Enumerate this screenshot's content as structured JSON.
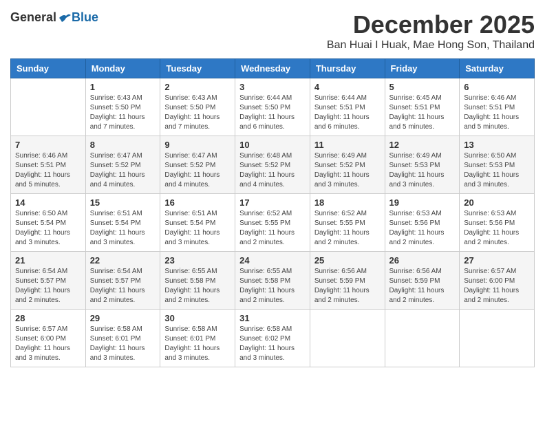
{
  "header": {
    "logo_general": "General",
    "logo_blue": "Blue",
    "month_title": "December 2025",
    "location": "Ban Huai I Huak, Mae Hong Son, Thailand"
  },
  "days_of_week": [
    "Sunday",
    "Monday",
    "Tuesday",
    "Wednesday",
    "Thursday",
    "Friday",
    "Saturday"
  ],
  "weeks": [
    [
      {
        "day": "",
        "info": ""
      },
      {
        "day": "1",
        "info": "Sunrise: 6:43 AM\nSunset: 5:50 PM\nDaylight: 11 hours and 7 minutes."
      },
      {
        "day": "2",
        "info": "Sunrise: 6:43 AM\nSunset: 5:50 PM\nDaylight: 11 hours and 7 minutes."
      },
      {
        "day": "3",
        "info": "Sunrise: 6:44 AM\nSunset: 5:50 PM\nDaylight: 11 hours and 6 minutes."
      },
      {
        "day": "4",
        "info": "Sunrise: 6:44 AM\nSunset: 5:51 PM\nDaylight: 11 hours and 6 minutes."
      },
      {
        "day": "5",
        "info": "Sunrise: 6:45 AM\nSunset: 5:51 PM\nDaylight: 11 hours and 5 minutes."
      },
      {
        "day": "6",
        "info": "Sunrise: 6:46 AM\nSunset: 5:51 PM\nDaylight: 11 hours and 5 minutes."
      }
    ],
    [
      {
        "day": "7",
        "info": "Sunrise: 6:46 AM\nSunset: 5:51 PM\nDaylight: 11 hours and 5 minutes."
      },
      {
        "day": "8",
        "info": "Sunrise: 6:47 AM\nSunset: 5:52 PM\nDaylight: 11 hours and 4 minutes."
      },
      {
        "day": "9",
        "info": "Sunrise: 6:47 AM\nSunset: 5:52 PM\nDaylight: 11 hours and 4 minutes."
      },
      {
        "day": "10",
        "info": "Sunrise: 6:48 AM\nSunset: 5:52 PM\nDaylight: 11 hours and 4 minutes."
      },
      {
        "day": "11",
        "info": "Sunrise: 6:49 AM\nSunset: 5:52 PM\nDaylight: 11 hours and 3 minutes."
      },
      {
        "day": "12",
        "info": "Sunrise: 6:49 AM\nSunset: 5:53 PM\nDaylight: 11 hours and 3 minutes."
      },
      {
        "day": "13",
        "info": "Sunrise: 6:50 AM\nSunset: 5:53 PM\nDaylight: 11 hours and 3 minutes."
      }
    ],
    [
      {
        "day": "14",
        "info": "Sunrise: 6:50 AM\nSunset: 5:54 PM\nDaylight: 11 hours and 3 minutes."
      },
      {
        "day": "15",
        "info": "Sunrise: 6:51 AM\nSunset: 5:54 PM\nDaylight: 11 hours and 3 minutes."
      },
      {
        "day": "16",
        "info": "Sunrise: 6:51 AM\nSunset: 5:54 PM\nDaylight: 11 hours and 3 minutes."
      },
      {
        "day": "17",
        "info": "Sunrise: 6:52 AM\nSunset: 5:55 PM\nDaylight: 11 hours and 2 minutes."
      },
      {
        "day": "18",
        "info": "Sunrise: 6:52 AM\nSunset: 5:55 PM\nDaylight: 11 hours and 2 minutes."
      },
      {
        "day": "19",
        "info": "Sunrise: 6:53 AM\nSunset: 5:56 PM\nDaylight: 11 hours and 2 minutes."
      },
      {
        "day": "20",
        "info": "Sunrise: 6:53 AM\nSunset: 5:56 PM\nDaylight: 11 hours and 2 minutes."
      }
    ],
    [
      {
        "day": "21",
        "info": "Sunrise: 6:54 AM\nSunset: 5:57 PM\nDaylight: 11 hours and 2 minutes."
      },
      {
        "day": "22",
        "info": "Sunrise: 6:54 AM\nSunset: 5:57 PM\nDaylight: 11 hours and 2 minutes."
      },
      {
        "day": "23",
        "info": "Sunrise: 6:55 AM\nSunset: 5:58 PM\nDaylight: 11 hours and 2 minutes."
      },
      {
        "day": "24",
        "info": "Sunrise: 6:55 AM\nSunset: 5:58 PM\nDaylight: 11 hours and 2 minutes."
      },
      {
        "day": "25",
        "info": "Sunrise: 6:56 AM\nSunset: 5:59 PM\nDaylight: 11 hours and 2 minutes."
      },
      {
        "day": "26",
        "info": "Sunrise: 6:56 AM\nSunset: 5:59 PM\nDaylight: 11 hours and 2 minutes."
      },
      {
        "day": "27",
        "info": "Sunrise: 6:57 AM\nSunset: 6:00 PM\nDaylight: 11 hours and 2 minutes."
      }
    ],
    [
      {
        "day": "28",
        "info": "Sunrise: 6:57 AM\nSunset: 6:00 PM\nDaylight: 11 hours and 3 minutes."
      },
      {
        "day": "29",
        "info": "Sunrise: 6:58 AM\nSunset: 6:01 PM\nDaylight: 11 hours and 3 minutes."
      },
      {
        "day": "30",
        "info": "Sunrise: 6:58 AM\nSunset: 6:01 PM\nDaylight: 11 hours and 3 minutes."
      },
      {
        "day": "31",
        "info": "Sunrise: 6:58 AM\nSunset: 6:02 PM\nDaylight: 11 hours and 3 minutes."
      },
      {
        "day": "",
        "info": ""
      },
      {
        "day": "",
        "info": ""
      },
      {
        "day": "",
        "info": ""
      }
    ]
  ]
}
